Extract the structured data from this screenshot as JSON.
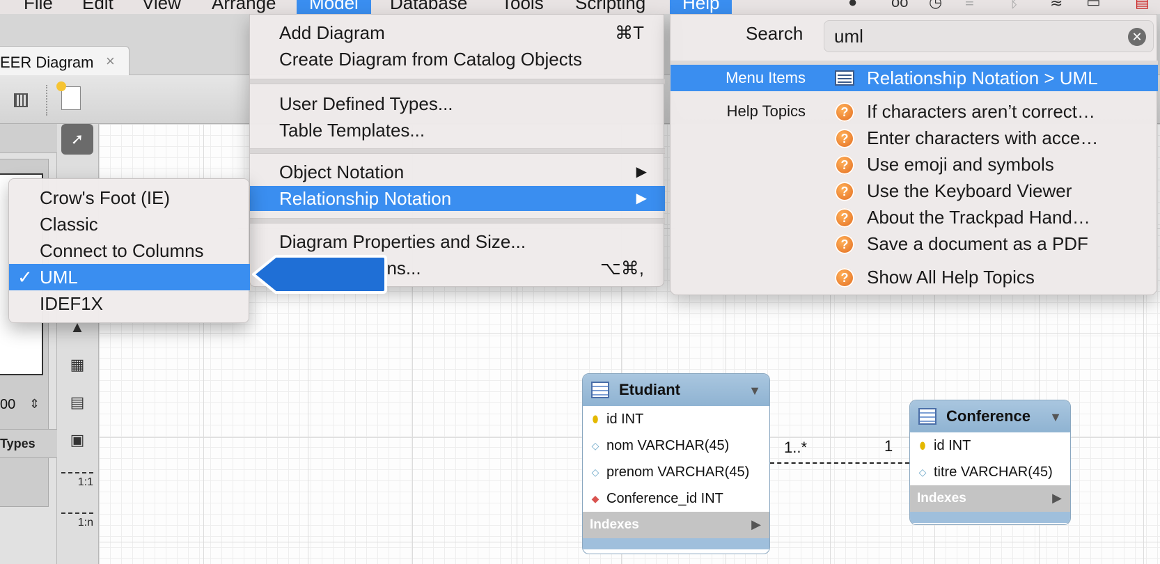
{
  "menubar": {
    "items": [
      "File",
      "Edit",
      "View",
      "Arrange",
      "Model",
      "Database",
      "Tools",
      "Scripting",
      "Help"
    ]
  },
  "document_tab": {
    "title": "EER Diagram",
    "close": "×"
  },
  "left_panel": {
    "zoom_value": "00",
    "types_label": "Types"
  },
  "palette": {
    "rel_1_1": "1:1",
    "rel_1_n": "1:n"
  },
  "model_menu": {
    "add_diagram": "Add Diagram",
    "add_diagram_shortcut": "⌘T",
    "create_from_catalog": "Create Diagram from Catalog Objects",
    "user_defined_types": "User Defined Types...",
    "table_templates": "Table Templates...",
    "object_notation": "Object Notation",
    "relationship_notation": "Relationship Notation",
    "diagram_properties": "Diagram Properties and Size...",
    "options": "ons...",
    "options_shortcut": "⌥⌘,"
  },
  "relationship_submenu": {
    "items": [
      "Crow's Foot (IE)",
      "Classic",
      "Connect to Columns",
      "UML",
      "IDEF1X"
    ],
    "checkmark": "✓"
  },
  "help_menu": {
    "search_label": "Search",
    "search_value": "uml",
    "menu_items_label": "Menu Items",
    "menu_result": "Relationship Notation > UML",
    "help_topics_label": "Help Topics",
    "topics": [
      "If characters aren’t correct…",
      "Enter characters with acce…",
      "Use emoji and symbols",
      "Use the Keyboard Viewer",
      "About the Trackpad Hand…",
      "Save a document as a PDF"
    ],
    "show_all": "Show All Help Topics"
  },
  "diagram": {
    "etudiant": {
      "name": "Etudiant",
      "columns": [
        "id INT",
        "nom VARCHAR(45)",
        "prenom VARCHAR(45)",
        "Conference_id INT"
      ],
      "indexes": "Indexes"
    },
    "conference": {
      "name": "Conference",
      "columns": [
        "id INT",
        "titre VARCHAR(45)"
      ],
      "indexes": "Indexes"
    },
    "relationship": {
      "card_left": "1..*",
      "card_right": "1"
    }
  },
  "colors": {
    "highlight": "#3a8ef0",
    "entity_header": "#9fbfdc",
    "help_arrow": "#1f6fd6"
  }
}
